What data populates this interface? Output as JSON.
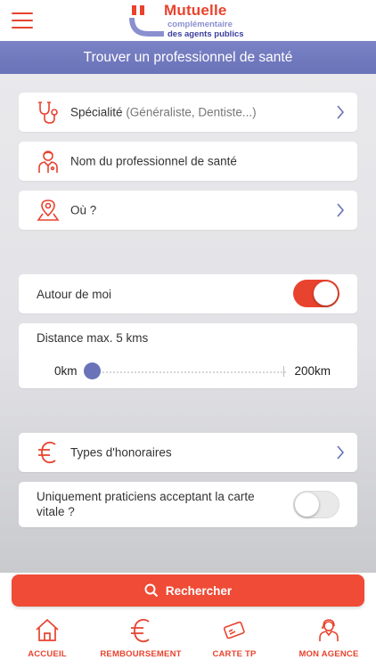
{
  "header": {
    "logo_line1": "Mutuelle",
    "logo_line2": "complémentaire",
    "logo_line3": "des agents publics"
  },
  "page_title": "Trouver un professionnel de santé",
  "search": {
    "speciality_label": "Spécialité",
    "speciality_hint": "(Généraliste, Dentiste...)",
    "name_label": "Nom du professionnel de santé",
    "where_label": "Où ?"
  },
  "filters": {
    "around_me_label": "Autour de moi",
    "around_me_on": true,
    "distance_label": "Distance max. 5 kms",
    "distance_min_label": "0km",
    "distance_max_label": "200km",
    "distance_value_km": 5,
    "fees_label": "Types d'honoraires",
    "vitale_label_line1": "Uniquement praticiens acceptant la carte",
    "vitale_label_line2": "vitale ?",
    "vitale_on": false
  },
  "search_button": "Rechercher",
  "tabs": [
    {
      "label": "ACCUEIL",
      "icon": "home-icon"
    },
    {
      "label": "REMBOURSEMENT",
      "icon": "euro-icon"
    },
    {
      "label": "CARTE TP",
      "icon": "card-icon"
    },
    {
      "label": "MON AGENCE",
      "icon": "agent-icon"
    }
  ],
  "colors": {
    "accent": "#e8432e",
    "primary": "#6a72b8",
    "background": "#e6e6ea"
  }
}
